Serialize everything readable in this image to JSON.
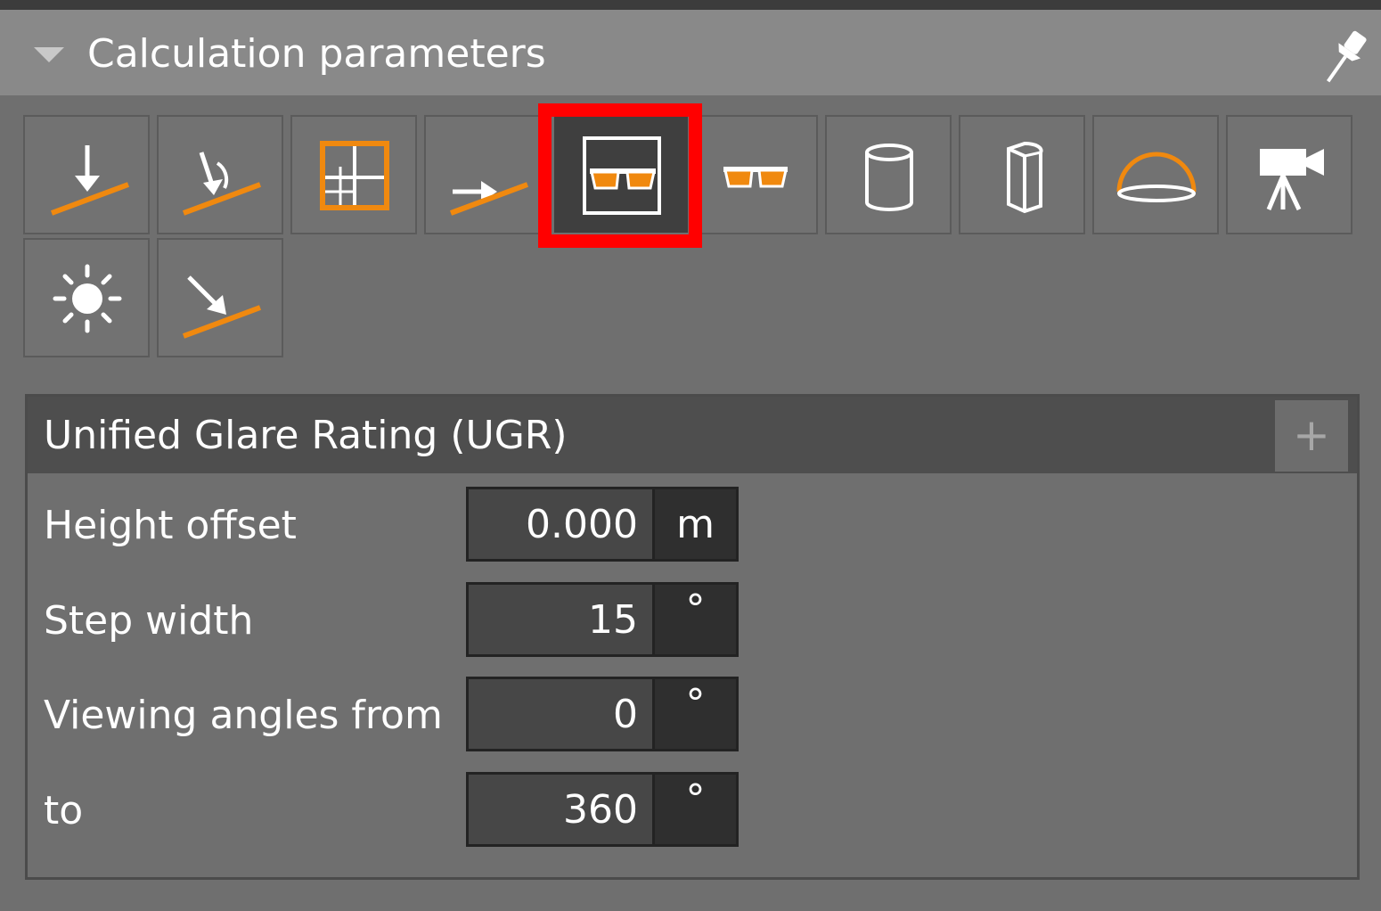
{
  "header": {
    "title": "Calculation parameters"
  },
  "toolbar": {
    "tools": [
      {
        "icon": "perpendicular-illuminance-icon"
      },
      {
        "icon": "adaptive-illuminance-icon"
      },
      {
        "icon": "grid-orange-icon"
      },
      {
        "icon": "horizontal-illuminance-icon"
      },
      {
        "icon": "ugr-glasses-icon",
        "selected": true
      },
      {
        "icon": "glasses-icon"
      },
      {
        "icon": "cylinder-icon"
      },
      {
        "icon": "semi-cylinder-icon"
      },
      {
        "icon": "hemisphere-icon"
      },
      {
        "icon": "camera-icon"
      },
      {
        "icon": "daylight-sun-icon"
      },
      {
        "icon": "vertical-illuminance-icon"
      }
    ],
    "accent_color": "#f0890f",
    "selection_color": "#ff0000"
  },
  "panel": {
    "title": "Unified Glare Rating (UGR)",
    "add_label": "+",
    "fields": [
      {
        "label": "Height offset",
        "value": "0.000",
        "unit": "m"
      },
      {
        "label": "Step width",
        "value": "15",
        "unit": "°"
      },
      {
        "label": "Viewing angles from",
        "value": "0",
        "unit": "°"
      },
      {
        "label": "to",
        "value": "360",
        "unit": "°"
      }
    ]
  }
}
